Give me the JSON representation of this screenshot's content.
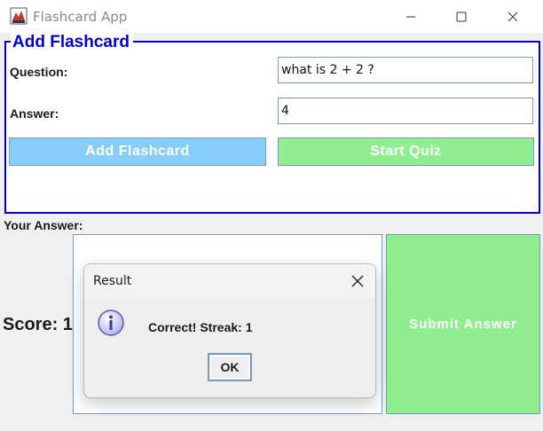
{
  "window": {
    "title": "Flashcard App",
    "controls": [
      "minimize-icon",
      "maximize-icon",
      "close-icon"
    ]
  },
  "add_panel": {
    "legend": "Add Flashcard",
    "question_label": "Question:",
    "question_value": "what is 2 + 2 ?",
    "answer_label": "Answer:",
    "answer_value": "4",
    "add_button": "Add Flashcard",
    "start_button": "Start Quiz"
  },
  "quiz": {
    "your_answer_label": "Your Answer:",
    "answer_value": "",
    "score_label": "Score: 1",
    "submit_button": "Submit Answer"
  },
  "dialog": {
    "title": "Result",
    "message": "Correct! Streak: 1",
    "ok_button": "OK",
    "icon": "info-icon"
  },
  "colors": {
    "legend_blue": "#0000cc",
    "add_button_bg": "#87cdfa",
    "start_button_bg": "#90ee90",
    "submit_button_bg": "#90ee90"
  }
}
